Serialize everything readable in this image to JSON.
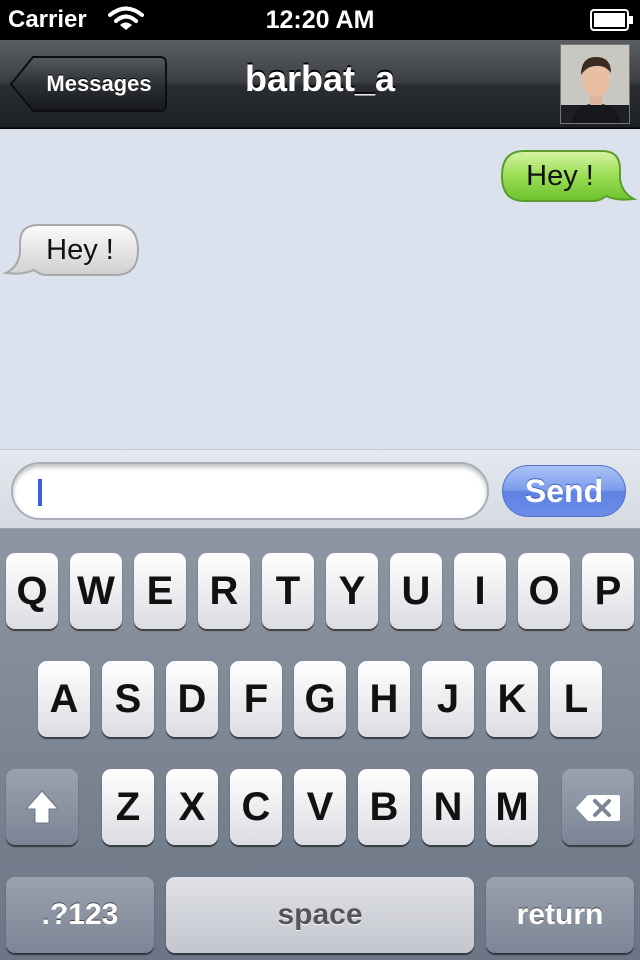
{
  "status_bar": {
    "carrier": "Carrier",
    "time": "12:20 AM",
    "wifi_icon": "wifi-icon",
    "battery_icon": "battery-icon"
  },
  "nav": {
    "back_label": "Messages",
    "title": "barbat_a",
    "avatar_icon": "contact-avatar"
  },
  "messages": [
    {
      "direction": "outgoing",
      "text": "Hey !",
      "color": "#7fd43a"
    },
    {
      "direction": "incoming",
      "text": "Hey !",
      "color": "#e4e4e4"
    }
  ],
  "composer": {
    "value": "",
    "send_label": "Send"
  },
  "keyboard": {
    "row1": [
      "Q",
      "W",
      "E",
      "R",
      "T",
      "Y",
      "U",
      "I",
      "O",
      "P"
    ],
    "row2": [
      "A",
      "S",
      "D",
      "F",
      "G",
      "H",
      "J",
      "K",
      "L"
    ],
    "row3": [
      "Z",
      "X",
      "C",
      "V",
      "B",
      "N",
      "M"
    ],
    "numbers_label": ".?123",
    "space_label": "space",
    "return_label": "return",
    "shift_icon": "shift-icon",
    "delete_icon": "backspace-icon"
  },
  "colors": {
    "accent": "#6a8de8",
    "conversation_bg": "#dbe1ed"
  }
}
